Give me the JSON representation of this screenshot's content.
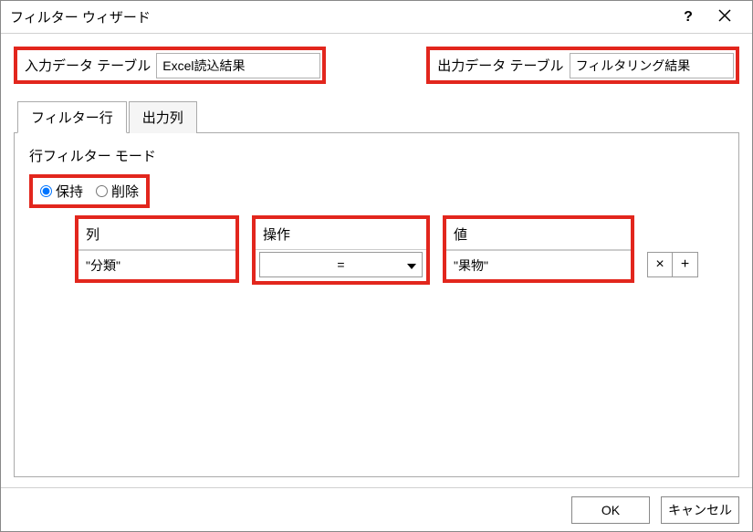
{
  "window": {
    "title": "フィルター ウィザード",
    "help_symbol": "?"
  },
  "io": {
    "input_label": "入力データ テーブル",
    "input_value": "Excel読込結果",
    "output_label": "出力データ テーブル",
    "output_value": "フィルタリング結果"
  },
  "tabs": {
    "filter_rows": "フィルター行",
    "output_cols": "出力列"
  },
  "mode": {
    "label": "行フィルター モード",
    "keep": "保持",
    "remove": "削除",
    "selected": "keep"
  },
  "filter": {
    "headers": {
      "column": "列",
      "operation": "操作",
      "value": "値"
    },
    "row": {
      "column": "\"分類\"",
      "operation": "=",
      "value": "\"果物\""
    },
    "buttons": {
      "remove": "×",
      "add": "+"
    }
  },
  "footer": {
    "ok": "OK",
    "cancel": "キャンセル"
  }
}
